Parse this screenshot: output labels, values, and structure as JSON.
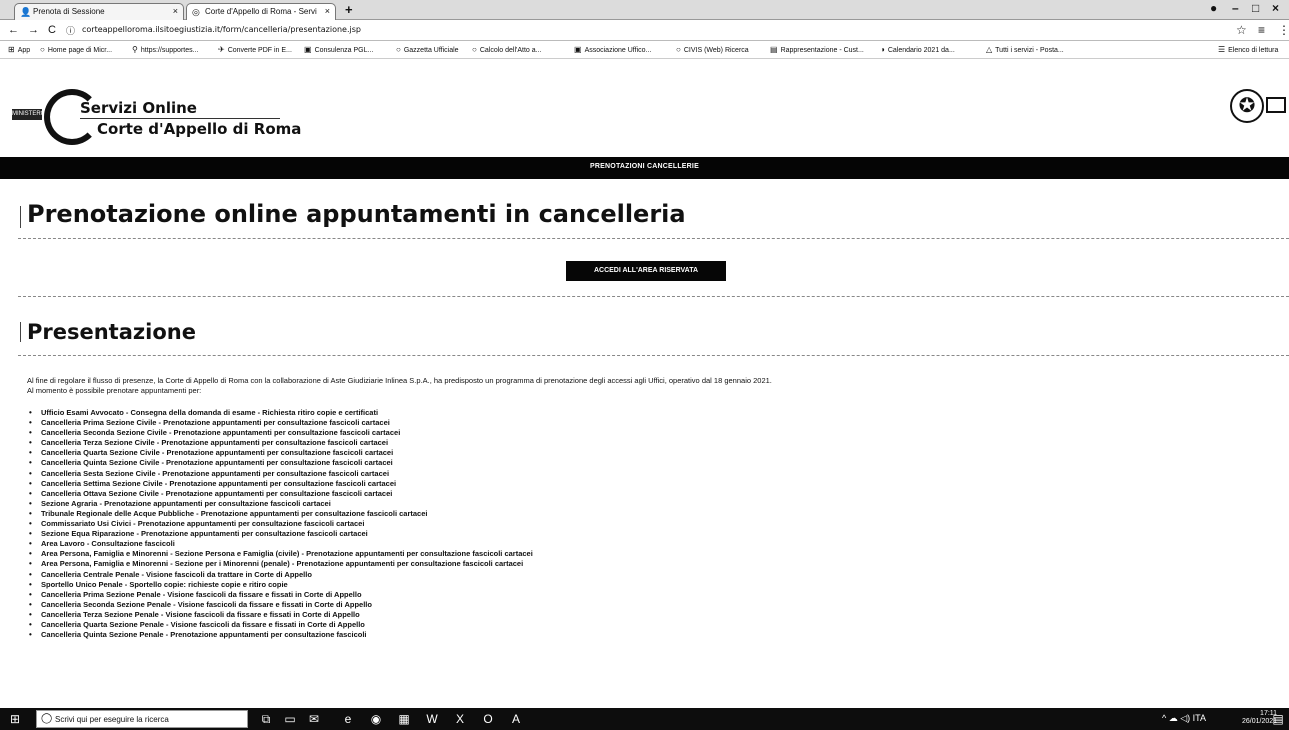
{
  "browser": {
    "tabs": [
      {
        "label": "Prenota di Sessione",
        "icon": "user-icon"
      },
      {
        "label": "Corte d'Appello di Roma - Servi",
        "icon": "globe-icon"
      }
    ],
    "new_tab": "+",
    "window_controls": {
      "minimize": "–",
      "maximize": "□",
      "close": "×"
    },
    "address": {
      "back": "←",
      "forward": "→",
      "reload": "C",
      "lock": "ⓘ",
      "url": "corteappelloroma.ilsitoegiustizia.it/form/cancelleria/presentazione.jsp"
    },
    "bookmarks": [
      {
        "label": "App",
        "icon": "apps-icon"
      },
      {
        "label": "Home page di Micr...",
        "icon": "globe-icon"
      },
      {
        "label": "https://supportes...",
        "icon": "link-icon"
      },
      {
        "label": "Converte PDF in E...",
        "icon": "convert-icon"
      },
      {
        "label": "Consulenza PGL...",
        "icon": "doc-icon"
      },
      {
        "label": "Gazzetta Ufficiale",
        "icon": "globe-icon"
      },
      {
        "label": "Calcolo dell'Atto a...",
        "icon": "globe-icon"
      },
      {
        "label": "Associazione Uffico...",
        "icon": "doc-icon"
      },
      {
        "label": "CIVIS (Web) Ricerca",
        "icon": "globe-icon"
      },
      {
        "label": "Rappresentazione - Cust...",
        "icon": "doc-icon"
      },
      {
        "label": "Calendario 2021 da...",
        "icon": "calendar-icon"
      },
      {
        "label": "Tutti i servizi - Posta...",
        "icon": "drive-icon"
      },
      {
        "label": "Elenco di lettura",
        "icon": "list-icon"
      }
    ]
  },
  "site": {
    "brand_line1": "Servizi Online",
    "brand_line2": "Corte d'Appello di Roma",
    "gov_logo": "MINISTERO",
    "emblem": "✪",
    "nav_item": "PRENOTAZIONI CANCELLERIE",
    "page_title": "Prenotazione online appuntamenti in cancelleria",
    "access_button": "ACCEDI ALL'AREA RISERVATA",
    "section_title": "Presentazione",
    "intro_line1": "Al fine di regolare il flusso di presenze, la Corte di Appello di Roma con la collaborazione di Aste Giudiziarie Inlinea S.p.A., ha predisposto un programma di prenotazione degli accessi agli Uffici, operativo dal 18 gennaio 2021.",
    "intro_line2": "Al momento è possibile prenotare appuntamenti per:",
    "services": [
      "Ufficio Esami Avvocato - Consegna della domanda di esame - Richiesta ritiro copie e certificati",
      "Cancelleria Prima Sezione Civile - Prenotazione appuntamenti per consultazione fascicoli cartacei",
      "Cancelleria Seconda Sezione Civile - Prenotazione appuntamenti per consultazione fascicoli cartacei",
      "Cancelleria Terza Sezione Civile - Prenotazione appuntamenti per consultazione fascicoli cartacei",
      "Cancelleria Quarta Sezione Civile - Prenotazione appuntamenti per consultazione fascicoli cartacei",
      "Cancelleria Quinta Sezione Civile - Prenotazione appuntamenti per consultazione fascicoli cartacei",
      "Cancelleria Sesta Sezione Civile - Prenotazione appuntamenti per consultazione fascicoli cartacei",
      "Cancelleria Settima Sezione Civile - Prenotazione appuntamenti per consultazione fascicoli cartacei",
      "Cancelleria Ottava Sezione Civile - Prenotazione appuntamenti per consultazione fascicoli cartacei",
      "Sezione Agraria - Prenotazione appuntamenti per consultazione fascicoli cartacei",
      "Tribunale Regionale delle Acque Pubbliche - Prenotazione appuntamenti per consultazione fascicoli cartacei",
      "Commissariato Usi Civici - Prenotazione appuntamenti per consultazione fascicoli cartacei",
      "Sezione Equa Riparazione - Prenotazione appuntamenti per consultazione fascicoli cartacei",
      "Area Lavoro - Consultazione fascicoli",
      "Area Persona, Famiglia e Minorenni - Sezione Persona e Famiglia (civile) - Prenotazione appuntamenti per consultazione fascicoli cartacei",
      "Area Persona, Famiglia e Minorenni - Sezione per i Minorenni (penale) - Prenotazione appuntamenti per consultazione fascicoli cartacei",
      "Cancelleria Centrale Penale - Visione fascicoli da trattare in Corte di Appello",
      "Sportello Unico Penale - Sportello copie: richieste copie e ritiro copie",
      "Cancelleria Prima Sezione Penale - Visione fascicoli da fissare e fissati in Corte di Appello",
      "Cancelleria Seconda Sezione Penale - Visione fascicoli da fissare e fissati in Corte di Appello",
      "Cancelleria Terza Sezione Penale - Visione fascicoli da fissare e fissati in Corte di Appello",
      "Cancelleria Quarta Sezione Penale - Visione fascicoli da fissare e fissati in Corte di Appello",
      "Cancelleria Quinta Sezione Penale - Prenotazione appuntamenti per consultazione fascicoli"
    ]
  },
  "taskbar": {
    "start": "⊞",
    "search_placeholder": "Scrivi qui per eseguire la ricerca",
    "search_icon": "◯",
    "apps": [
      "task-view-icon",
      "file-explorer-icon",
      "mail-icon",
      "edge-icon",
      "chrome-icon",
      "store-icon",
      "word-icon",
      "excel-icon",
      "outlook-icon",
      "acrobat-icon"
    ],
    "tray": "^ ☁ ◁) ITA",
    "time": "17:11",
    "date": "26/01/2021"
  }
}
